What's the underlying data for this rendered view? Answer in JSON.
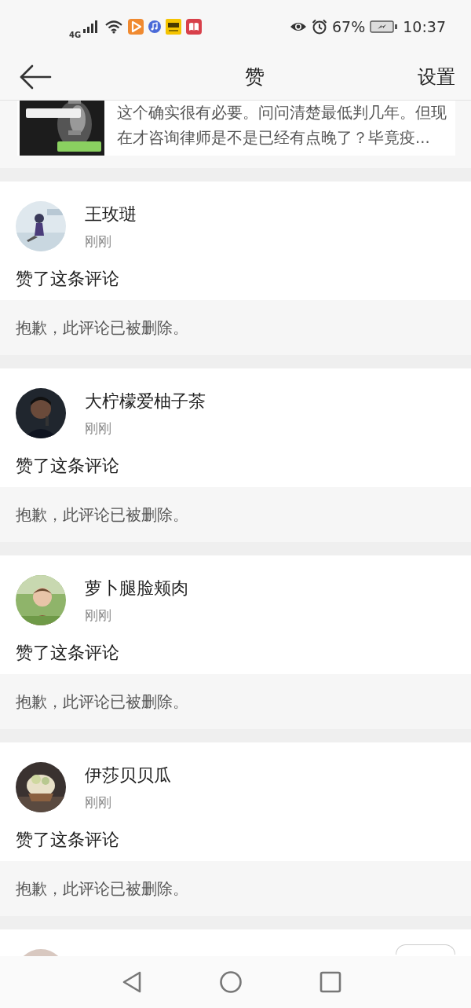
{
  "status_bar": {
    "network": "4G",
    "battery": "67%",
    "time": "10:37"
  },
  "header": {
    "title": "赞",
    "action": "设置"
  },
  "top_card": {
    "kind": "picture",
    "text": "这个确实很有必要。问问清楚最低判几年。但现在才咨询律师是不是已经有点晚了？毕竟疫..."
  },
  "items": [
    {
      "kind": "like",
      "name": "王玫琎",
      "time": "刚刚",
      "action": "赞了这条评论",
      "quote": "抱歉，此评论已被删除。"
    },
    {
      "kind": "like",
      "name": "大柠檬爱柚子茶",
      "time": "刚刚",
      "action": "赞了这条评论",
      "quote": "抱歉，此评论已被删除。"
    },
    {
      "kind": "like",
      "name": "萝卜腿脸颊肉",
      "time": "刚刚",
      "action": "赞了这条评论",
      "quote": "抱歉，此评论已被删除。"
    },
    {
      "kind": "like",
      "name": "伊莎贝贝瓜",
      "time": "刚刚",
      "action": "赞了这条评论",
      "quote": "抱歉，此评论已被删除。"
    },
    {
      "kind": "partial"
    }
  ]
}
